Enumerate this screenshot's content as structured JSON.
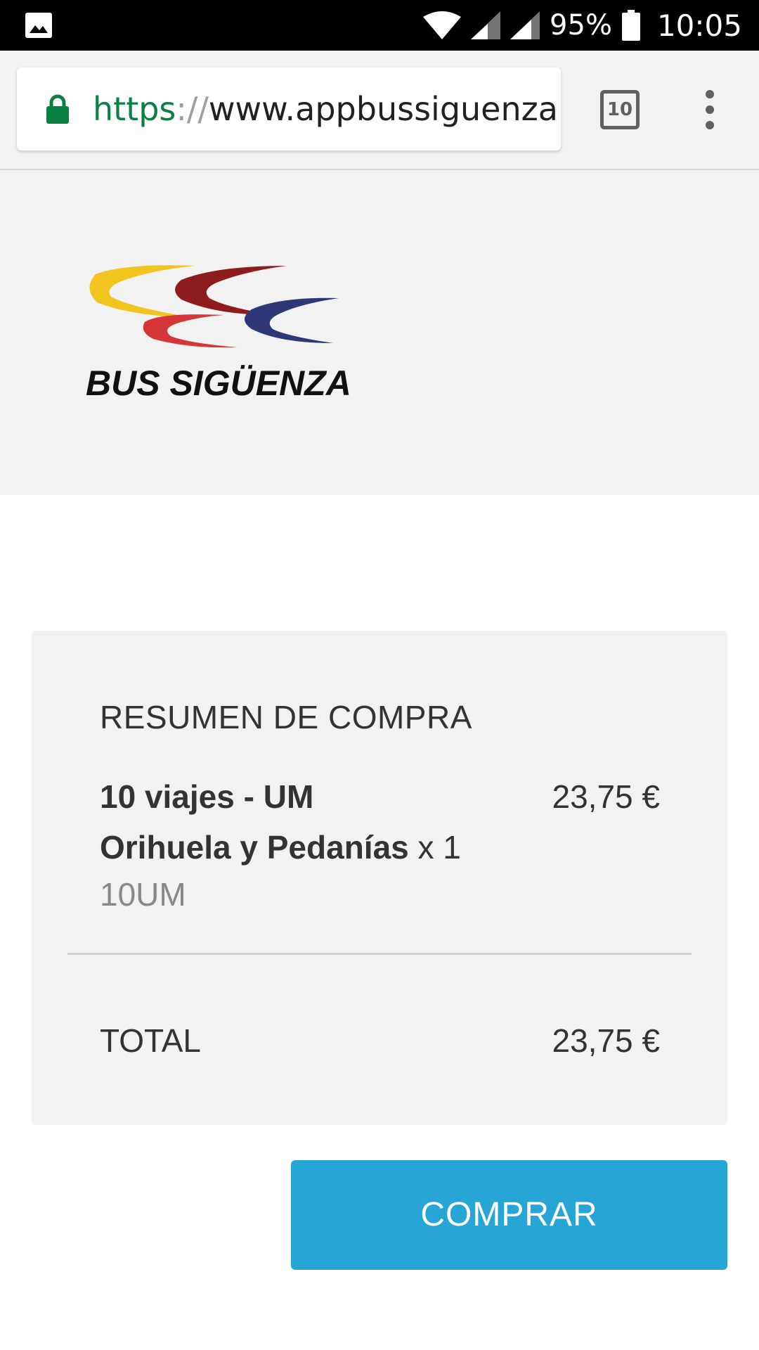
{
  "status_bar": {
    "battery": "95%",
    "time": "10:05",
    "icons": [
      "image-icon",
      "wifi-icon",
      "signal-icon",
      "signal-icon-2",
      "battery-icon"
    ]
  },
  "browser": {
    "url_scheme": "https",
    "url_separator": "://",
    "url_host": "www.appbussiguenza.com",
    "tab_count": "10",
    "colors": {
      "secure": "#0b8043"
    }
  },
  "header": {
    "logo_text": "BUS SIGÜENZA",
    "logo_colors": [
      "#f2c420",
      "#8e1c1c",
      "#d6363a",
      "#2e3877"
    ]
  },
  "summary": {
    "title": "RESUMEN DE COMPRA",
    "item_name_line1": "10 viajes - UM",
    "item_name_line2": "Orihuela y Pedanías",
    "item_qty": " x 1",
    "item_code": "10UM",
    "item_price": "23,75 €",
    "total_label": "TOTAL",
    "total_value": "23,75 €"
  },
  "actions": {
    "buy_label": "COMPRAR",
    "buy_color": "#27a6d6"
  }
}
